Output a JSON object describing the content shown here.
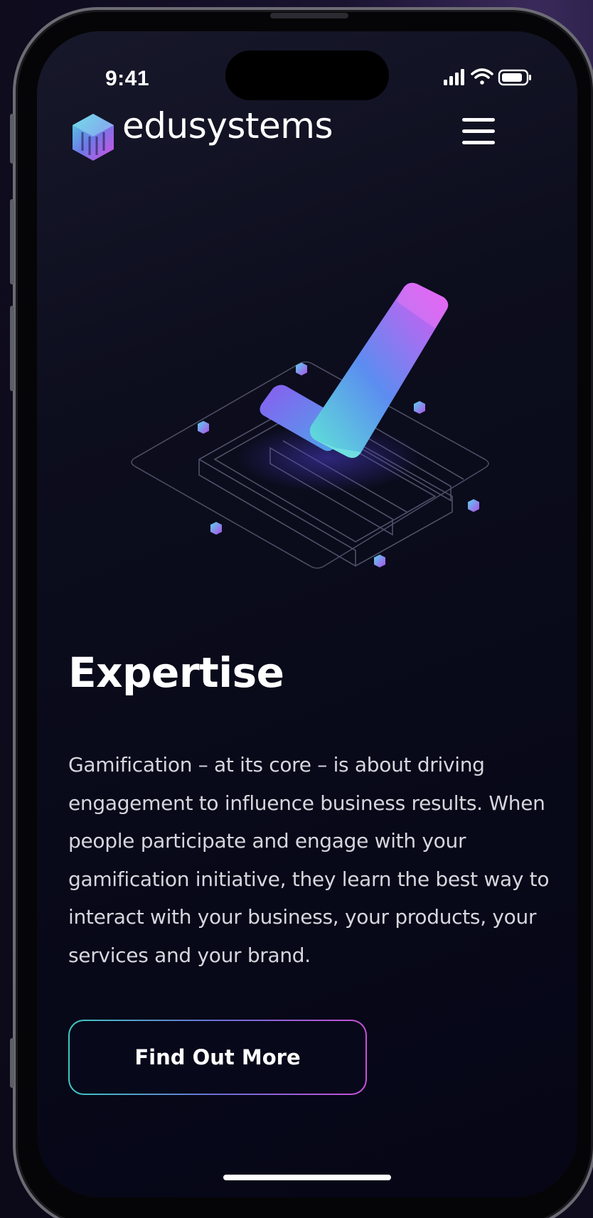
{
  "status_bar": {
    "time": "9:41",
    "icons": [
      "cellular-signal-icon",
      "wifi-icon",
      "battery-icon"
    ]
  },
  "header": {
    "brand": "edusystems",
    "logo_icon": "edusystems-logo-icon",
    "menu_icon": "hamburger-menu-icon"
  },
  "hero": {
    "illustration": "checkmark-isometric-illustration"
  },
  "content": {
    "title": "Expertise",
    "body": "Gamification – at its core – is about driving engagement to influence business results. When people participate and engage with your gamification initiative, they learn the best way to interact with your business, your products, your services and your brand.",
    "cta_label": "Find Out More"
  },
  "colors": {
    "background": "#070818",
    "accent_teal": "#3ec8c0",
    "accent_purple": "#6b6fd6",
    "accent_magenta": "#c84fd8",
    "text_primary": "#ffffff",
    "text_secondary": "#d6d6de"
  }
}
